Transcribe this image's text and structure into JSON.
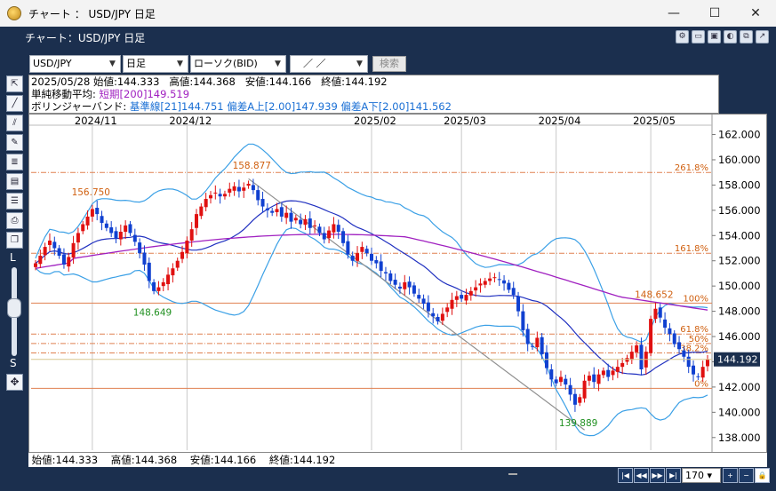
{
  "window": {
    "title": "チャート ： USD/JPY 日足",
    "inner_title": "チャート：USD/JPY 日足"
  },
  "controls": {
    "pair": "USD/JPY",
    "timeframe": "日足",
    "price_type": "ローソク(BID)",
    "date_value": "／ ／",
    "search_label": "検索"
  },
  "info": {
    "date": "2025/05/28",
    "open_label": "始値:",
    "open": "144.333",
    "high_label": "高値:",
    "high": "144.368",
    "low_label": "安値:",
    "low": "144.166",
    "close_label": "終値:",
    "close": "144.192",
    "ma_label": "単純移動平均:",
    "ma_name": "短期[200]",
    "ma_value": "149.519",
    "bb_label": "ボリンジャーバンド:",
    "bb_mid_name": "基準線[21]",
    "bb_mid": "144.751",
    "bb_up_name": "偏差A上[2.00]",
    "bb_up": "147.939",
    "bb_low_name": "偏差A下[2.00]",
    "bb_low": "141.562"
  },
  "left_labels": {
    "large": "L",
    "small": "S"
  },
  "chart_data": {
    "type": "candlestick",
    "x_tick_labels": [
      {
        "label": "2024/11",
        "index": 12
      },
      {
        "label": "2024/12",
        "index": 32
      },
      {
        "label": "2025/02",
        "index": 71
      },
      {
        "label": "2025/03",
        "index": 90
      },
      {
        "label": "2025/04",
        "index": 110
      },
      {
        "label": "2025/05",
        "index": 130
      }
    ],
    "y_ticks": [
      "162.000",
      "160.000",
      "158.000",
      "156.000",
      "154.000",
      "152.000",
      "150.000",
      "148.000",
      "146.000",
      "144.000",
      "142.000",
      "140.000",
      "138.000"
    ],
    "ylim": [
      137.0,
      162.6
    ],
    "current_price": "144.192",
    "fib_levels": [
      {
        "label": "261.8%",
        "value": 159.0
      },
      {
        "label": "161.8%",
        "value": 152.6
      },
      {
        "label": "100%",
        "value": 148.65
      },
      {
        "label": "61.8%",
        "value": 146.2
      },
      {
        "label": "50%",
        "value": 145.45
      },
      {
        "label": "38.2%",
        "value": 144.7
      },
      {
        "label": "0%",
        "value": 141.9
      }
    ],
    "annotations": [
      {
        "text": "156.750",
        "index": 11,
        "value": 156.75,
        "color": "#d06010"
      },
      {
        "text": "158.877",
        "index": 45,
        "value": 158.877,
        "color": "#d06010"
      },
      {
        "text": "148.649",
        "index": 24,
        "value": 148.649,
        "color": "#209020"
      },
      {
        "text": "148.652",
        "index": 130,
        "value": 148.652,
        "color": "#d06010"
      },
      {
        "text": "139.889",
        "index": 114,
        "value": 139.889,
        "color": "#209020"
      }
    ],
    "closes": [
      151.8,
      152.4,
      153.1,
      153.6,
      153.0,
      152.4,
      151.7,
      152.3,
      153.4,
      154.2,
      154.9,
      155.5,
      156.1,
      155.7,
      155.0,
      154.6,
      154.2,
      153.8,
      154.3,
      154.8,
      154.2,
      153.5,
      152.6,
      151.7,
      150.4,
      149.6,
      149.9,
      150.3,
      150.9,
      151.4,
      152.0,
      152.7,
      153.6,
      154.5,
      155.7,
      156.3,
      156.9,
      157.2,
      157.4,
      157.1,
      157.3,
      157.7,
      157.9,
      157.5,
      157.8,
      158.1,
      157.6,
      156.8,
      156.3,
      156.0,
      155.8,
      156.1,
      155.5,
      155.8,
      155.1,
      155.4,
      154.9,
      155.3,
      154.6,
      154.8,
      154.2,
      153.7,
      154.4,
      154.9,
      154.3,
      153.4,
      152.5,
      152.0,
      152.6,
      153.1,
      152.6,
      152.0,
      151.8,
      151.2,
      151.0,
      150.4,
      150.1,
      149.8,
      150.3,
      149.9,
      149.4,
      149.0,
      148.6,
      148.0,
      147.6,
      147.2,
      147.8,
      148.3,
      148.9,
      149.2,
      149.0,
      149.3,
      149.6,
      149.9,
      150.2,
      150.4,
      150.6,
      150.7,
      150.5,
      150.2,
      149.7,
      149.3,
      148.0,
      146.5,
      145.4,
      145.2,
      145.9,
      144.6,
      143.5,
      142.6,
      142.3,
      142.8,
      142.2,
      141.4,
      140.6,
      141.2,
      142.5,
      142.9,
      142.4,
      143.0,
      143.3,
      142.8,
      143.3,
      143.6,
      143.9,
      144.3,
      144.8,
      145.3,
      143.4,
      144.8,
      147.4,
      148.2,
      147.5,
      146.7,
      146.2,
      145.4,
      145.0,
      144.4,
      143.6,
      143.0,
      142.8,
      143.6,
      144.2
    ]
  }
}
